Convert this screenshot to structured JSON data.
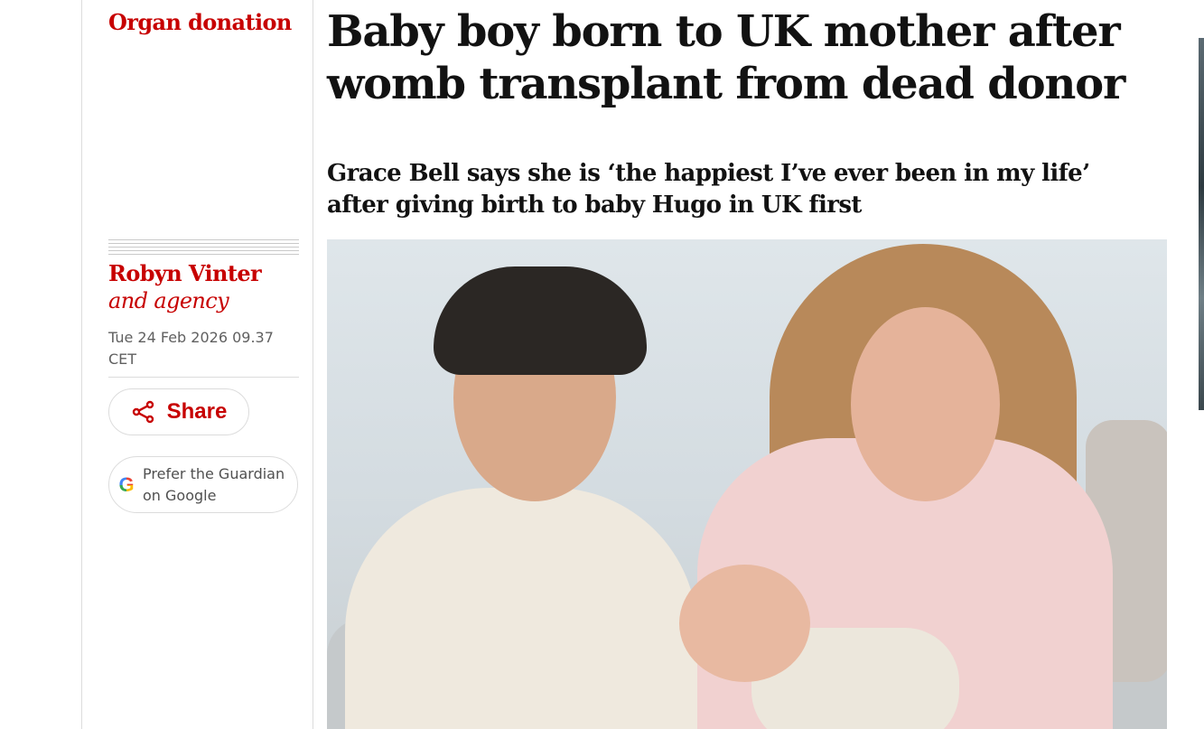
{
  "section": {
    "kicker": "Organ donation"
  },
  "article": {
    "headline": "Baby boy born to UK mother after womb transplant from dead donor",
    "standfirst_line1": "Grace Bell says she is ‘the happiest I’ve ever been in my life’",
    "standfirst_line2": "after giving birth to baby Hugo in UK first"
  },
  "meta": {
    "byline_name": "Robyn Vinter",
    "byline_extra": "and agency",
    "date_line1": "Tue 24 Feb 2026 09.37",
    "date_line2": "CET",
    "share_label": "Share",
    "google_line1": "Prefer the Guardian",
    "google_line2": "on Google"
  },
  "icons": {
    "share": "share-icon",
    "google": "google-g-icon"
  },
  "colors": {
    "accent": "#c70000",
    "text": "#121212",
    "muted": "#606060"
  }
}
